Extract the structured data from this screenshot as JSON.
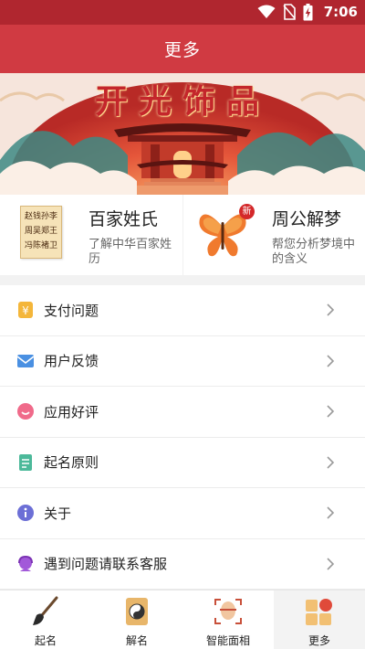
{
  "status_bar": {
    "time": "7:06",
    "icons": [
      "wifi-icon",
      "no-sim-icon",
      "battery-charging-icon"
    ]
  },
  "header": {
    "title": "更多"
  },
  "banner": {
    "title": "开光饰品"
  },
  "features": [
    {
      "title": "百家姓氏",
      "desc": "了解中华百家姓历",
      "thumb_lines": [
        "赵钱孙李",
        "周吴郑王",
        "冯陈褚卫"
      ]
    },
    {
      "title": "周公解梦",
      "desc": "帮您分析梦境中的含义",
      "badge": "新"
    }
  ],
  "menu": [
    {
      "label": "支付问题",
      "icon": "payment-icon"
    },
    {
      "label": "用户反馈",
      "icon": "feedback-mail-icon"
    },
    {
      "label": "应用好评",
      "icon": "rating-icon"
    },
    {
      "label": "起名原则",
      "icon": "document-icon"
    },
    {
      "label": "关于",
      "icon": "info-icon"
    },
    {
      "label": "遇到问题请联系客服",
      "icon": "customer-service-icon"
    }
  ],
  "tabs": [
    {
      "label": "起名",
      "icon": "brush-icon"
    },
    {
      "label": "解名",
      "icon": "taiji-icon"
    },
    {
      "label": "智能面相",
      "icon": "face-scan-icon"
    },
    {
      "label": "更多",
      "icon": "more-icon",
      "active": true
    }
  ],
  "colors": {
    "header": "#d03a42",
    "status_bar": "#b0262f",
    "accent_red": "#d93a37"
  }
}
